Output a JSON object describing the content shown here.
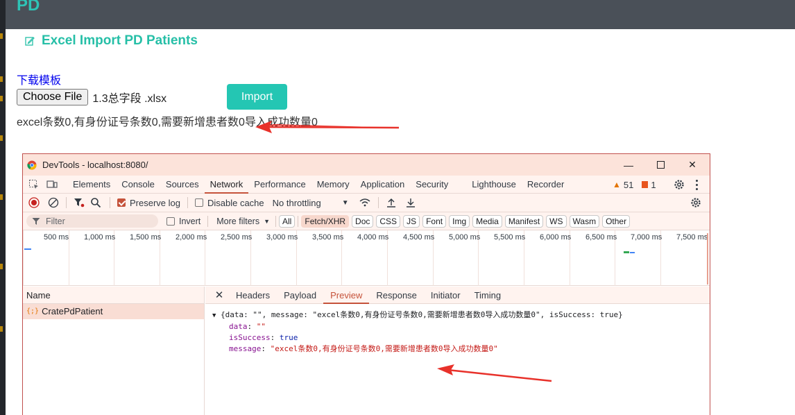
{
  "app": {
    "logo": "PD"
  },
  "page": {
    "title": "Excel Import PD Patients",
    "download_link": "下载模板",
    "choose_file_label": "Choose File",
    "file_name": "1.3总字段 .xlsx",
    "import_label": "Import",
    "result_text": "excel条数0,有身份证号条数0,需要新增患者数0导入成功数量0"
  },
  "devtools": {
    "window_title": "DevTools - localhost:8080/",
    "tabs": [
      "Elements",
      "Console",
      "Sources",
      "Network",
      "Performance",
      "Memory",
      "Application",
      "Security",
      "Lighthouse",
      "Recorder"
    ],
    "active_tab": "Network",
    "warnings_count": "51",
    "issues_count": "1",
    "toolbar": {
      "preserve_log": "Preserve log",
      "disable_cache": "Disable cache",
      "throttling": "No throttling"
    },
    "filter": {
      "placeholder": "Filter",
      "invert": "Invert",
      "more_filters": "More filters",
      "chips": [
        "All",
        "Fetch/XHR",
        "Doc",
        "CSS",
        "JS",
        "Font",
        "Img",
        "Media",
        "Manifest",
        "WS",
        "Wasm",
        "Other"
      ]
    },
    "timeline_labels": [
      "500 ms",
      "1,000 ms",
      "1,500 ms",
      "2,000 ms",
      "2,500 ms",
      "3,000 ms",
      "3,500 ms",
      "4,000 ms",
      "4,500 ms",
      "5,000 ms",
      "5,500 ms",
      "6,000 ms",
      "6,500 ms",
      "7,000 ms",
      "7,500 ms"
    ],
    "name_header": "Name",
    "request_name": "CratePdPatient",
    "preview_tabs": [
      "Headers",
      "Payload",
      "Preview",
      "Response",
      "Initiator",
      "Timing"
    ],
    "active_preview_tab": "Preview",
    "preview": {
      "summary": "{data: \"\", message: \"excel条数0,有身份证号条数0,需要新增患者数0导入成功数量0\", isSuccess: true}",
      "data_key": "data",
      "data_value": "\"\"",
      "isSuccess_key": "isSuccess",
      "isSuccess_value": "true",
      "message_key": "message",
      "message_value": "\"excel条数0,有身份证号条数0,需要新增患者数0导入成功数量0\""
    }
  },
  "colors": {
    "accent": "#24c6b3",
    "header": "#4a5058",
    "devtools_tab_active": "#c5523a",
    "annotation_arrow": "#e8312a"
  }
}
